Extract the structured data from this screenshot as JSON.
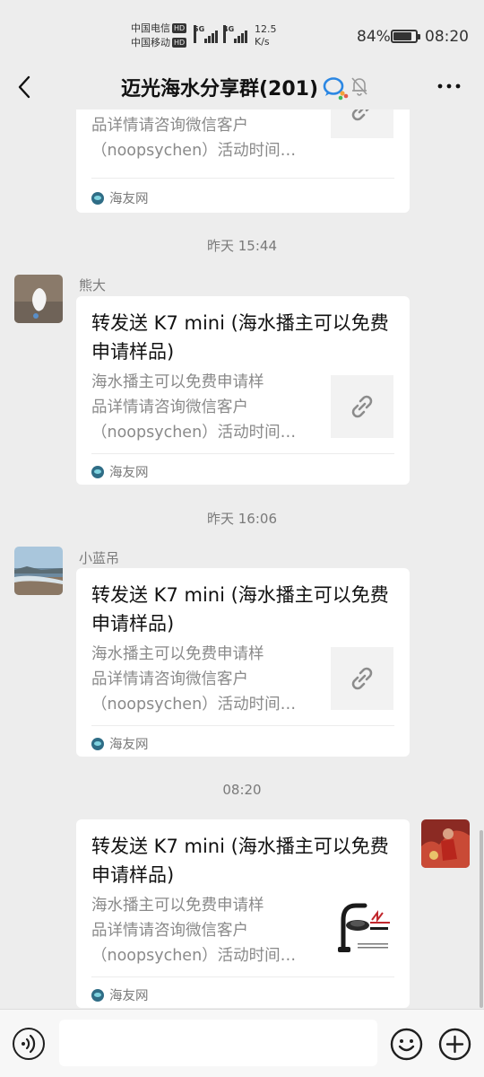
{
  "status_bar": {
    "carrier_1": "中国电信",
    "carrier_2": "中国移动",
    "hd_badge": "HD",
    "gen_1": "5G",
    "gen_2": "4G",
    "speed_value": "12.5",
    "speed_unit": "K/s",
    "battery_percent": "84%",
    "battery_level": 0.84,
    "time": "08:20"
  },
  "header": {
    "title": "迈光海水分享群(201)"
  },
  "messages": [
    {
      "partial": true,
      "card": {
        "title": "",
        "desc_lines": [
          "海水播主可以免费申请样",
          "品详情请咨询微信客户",
          "（noopsychen）活动时间…"
        ],
        "source": "海友网",
        "thumb": "link-icon"
      }
    },
    {
      "time": "昨天 15:44",
      "sender": "熊大",
      "card": {
        "title": "转发送 K7 mini (海水播主可以免费申请样品)",
        "desc_lines": [
          "海水播主可以免费申请样",
          "品详情请咨询微信客户",
          "（noopsychen）活动时间…"
        ],
        "source": "海友网",
        "thumb": "link-icon"
      }
    },
    {
      "time": "昨天 16:06",
      "sender": "小蓝吊",
      "card": {
        "title": "转发送 K7 mini (海水播主可以免费申请样品)",
        "desc_lines": [
          "海水播主可以免费申请样",
          "品详情请咨询微信客户",
          "（noopsychen）活动时间…"
        ],
        "source": "海友网",
        "thumb": "link-icon"
      }
    },
    {
      "time": "08:20",
      "sender": "",
      "self": true,
      "card": {
        "title": "转发送 K7 mini (海水播主可以免费申请样品)",
        "desc_lines": [
          "海水播主可以免费申请样",
          "品详情请咨询微信客户",
          "（noopsychen）活动时间…"
        ],
        "source": "海友网",
        "thumb": "product-image"
      }
    }
  ],
  "input": {
    "placeholder": ""
  },
  "colors": {
    "background": "#ededed",
    "card": "#ffffff",
    "muted_text": "#8a8a8a",
    "source_icon": "#2f6d86"
  }
}
